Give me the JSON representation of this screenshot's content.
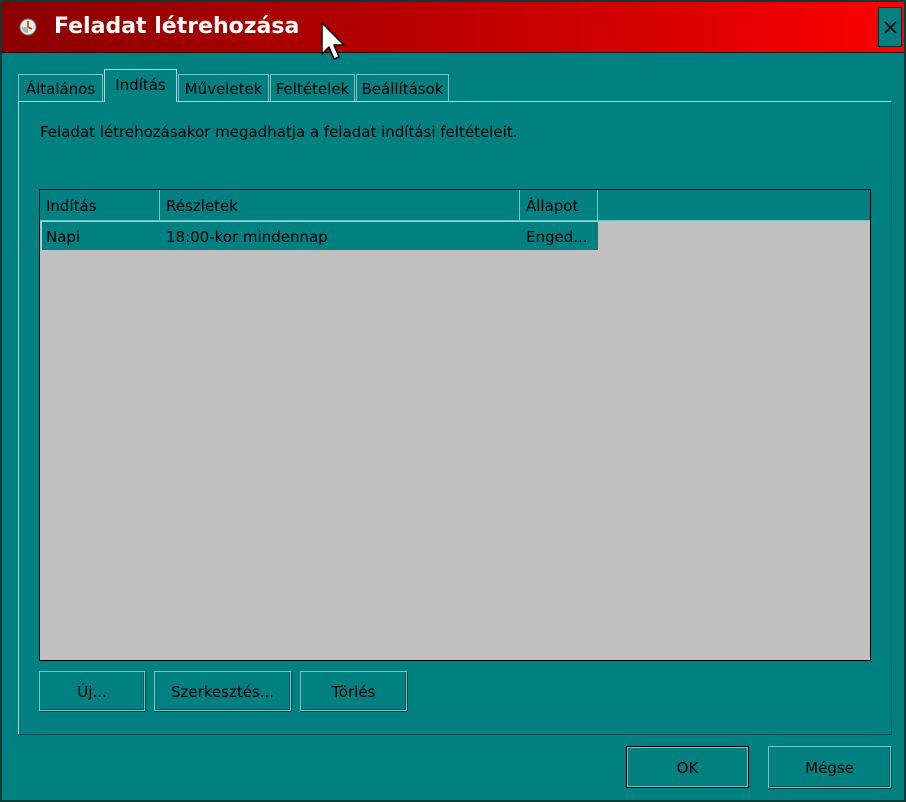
{
  "window": {
    "title": "Feladat létrehozása",
    "close_glyph": "✕",
    "titlebar_color_start": "#8a0000",
    "titlebar_color_end": "#ff0000",
    "background_color": "#008080"
  },
  "tabs": [
    {
      "label": "Általános",
      "active": false
    },
    {
      "label": "Indítás",
      "active": true
    },
    {
      "label": "Műveletek",
      "active": false
    },
    {
      "label": "Feltételek",
      "active": false
    },
    {
      "label": "Beállítások",
      "active": false
    }
  ],
  "trigger_panel": {
    "description": "Feladat létrehozásakor megadhatja a feladat indítási feltételeit.",
    "columns": [
      "Indítás",
      "Részletek",
      "Állapot"
    ],
    "rows": [
      {
        "trigger": "Napi",
        "details": "18:00-kor mindennap",
        "status": "Enged..."
      }
    ],
    "buttons": {
      "new": "Új...",
      "edit": "Szerkesztés...",
      "delete": "Törlés"
    }
  },
  "footer": {
    "ok": "OK",
    "cancel": "Mégse"
  },
  "icons": {
    "title_icon": "clock-icon",
    "cursor": "mouse-pointer-icon"
  }
}
